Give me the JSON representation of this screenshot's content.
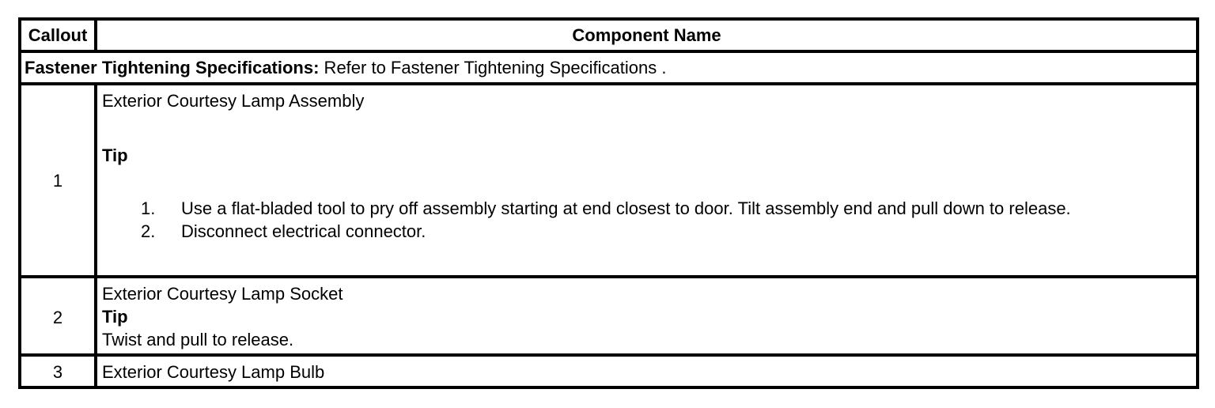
{
  "header": {
    "callout": "Callout",
    "component_name": "Component Name"
  },
  "spec_row": {
    "label": "Fastener Tightening Specifications:",
    "text": " Refer to Fastener Tightening Specifications ."
  },
  "rows": [
    {
      "callout": "1",
      "name": "Exterior Courtesy Lamp Assembly",
      "tip_label": "Tip",
      "steps": [
        {
          "num": "1.",
          "text": "Use a flat-bladed tool to pry off assembly starting at end closest to door. Tilt assembly end and pull down to release."
        },
        {
          "num": "2.",
          "text": "Disconnect electrical connector."
        }
      ]
    },
    {
      "callout": "2",
      "name": "Exterior Courtesy Lamp Socket",
      "tip_label": "Tip",
      "tip_text": "Twist and pull to release."
    },
    {
      "callout": "3",
      "name": "Exterior Courtesy Lamp Bulb"
    }
  ]
}
